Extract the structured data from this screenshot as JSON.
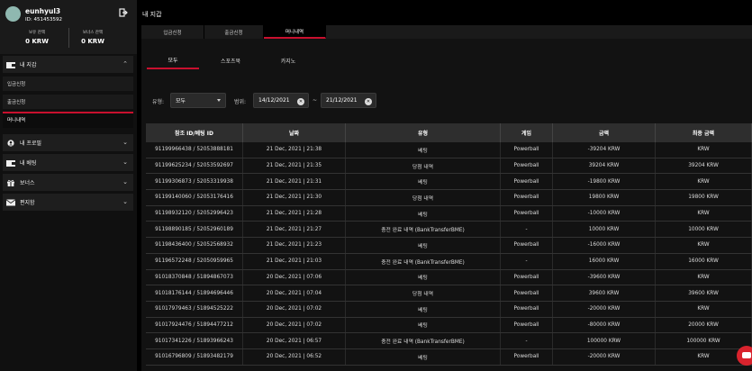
{
  "profile": {
    "username": "eunhyul3",
    "id_label": "ID: 451453592",
    "held_balance_label": "보유 잔액",
    "held_balance_value": "0 KRW",
    "bonus_balance_label": "보너스 잔액",
    "bonus_balance_value": "0 KRW"
  },
  "sidebar": {
    "wallet": "내 지갑",
    "deposit": "입금신청",
    "withdraw": "출금신청",
    "money_history": "머니내역",
    "profile": "내 프로필",
    "betting": "내 베팅",
    "bonus": "보너스",
    "mailbox": "편지함"
  },
  "main": {
    "title": "내 지갑",
    "tabs": [
      "입금신청",
      "출금신청",
      "머니내역"
    ],
    "subtabs": [
      "모두",
      "스포츠북",
      "카지노"
    ],
    "filter": {
      "type_label": "유형:",
      "type_value": "모두",
      "range_label": "범위:",
      "date_from": "14/12/2021",
      "date_sep": "~",
      "date_to": "21/12/2021"
    }
  },
  "table": {
    "headers": [
      "참조 ID/베팅 ID",
      "날짜",
      "유형",
      "게임",
      "금액",
      "최종 금액"
    ],
    "rows": [
      [
        "91199966438 / 52053888181",
        "21 Dec, 2021 | 21:38",
        "베팅",
        "Powerball",
        "-39204 KRW",
        "KRW"
      ],
      [
        "91199625234 / 52053592697",
        "21 Dec, 2021 | 21:35",
        "당첨 내역",
        "Powerball",
        "39204 KRW",
        "39204 KRW"
      ],
      [
        "91199306873 / 52053319938",
        "21 Dec, 2021 | 21:31",
        "베팅",
        "Powerball",
        "-19800 KRW",
        "KRW"
      ],
      [
        "91199140060 / 52053176416",
        "21 Dec, 2021 | 21:30",
        "당첨 내역",
        "Powerball",
        "19800 KRW",
        "19800 KRW"
      ],
      [
        "91198932120 / 52052996423",
        "21 Dec, 2021 | 21:28",
        "베팅",
        "Powerball",
        "-10000 KRW",
        "KRW"
      ],
      [
        "91198890185 / 52052960189",
        "21 Dec, 2021 | 21:27",
        "충전 완료 내역 (BankTransferBME)",
        "-",
        "10000 KRW",
        "10000 KRW"
      ],
      [
        "91198436400 / 52052568932",
        "21 Dec, 2021 | 21:23",
        "베팅",
        "Powerball",
        "-16000 KRW",
        "KRW"
      ],
      [
        "91196572248 / 52050959965",
        "21 Dec, 2021 | 21:03",
        "충전 완료 내역 (BankTransferBME)",
        "-",
        "16000 KRW",
        "16000 KRW"
      ],
      [
        "91018370848 / 51894867073",
        "20 Dec, 2021 | 07:06",
        "베팅",
        "Powerball",
        "-39600 KRW",
        "KRW"
      ],
      [
        "91018176144 / 51894696446",
        "20 Dec, 2021 | 07:04",
        "당첨 내역",
        "Powerball",
        "39600 KRW",
        "39600 KRW"
      ],
      [
        "91017979463 / 51894525222",
        "20 Dec, 2021 | 07:02",
        "베팅",
        "Powerball",
        "-20000 KRW",
        "KRW"
      ],
      [
        "91017924476 / 51894477212",
        "20 Dec, 2021 | 07:02",
        "베팅",
        "Powerball",
        "-80000 KRW",
        "20000 KRW"
      ],
      [
        "91017341226 / 51893966243",
        "20 Dec, 2021 | 06:57",
        "충전 완료 내역 (BankTransferBME)",
        "-",
        "100000 KRW",
        "100000 KRW"
      ],
      [
        "91016796809 / 51893482179",
        "20 Dec, 2021 | 06:52",
        "베팅",
        "Powerball",
        "-20000 KRW",
        "KRW"
      ]
    ]
  },
  "colors": {
    "accent": "#c8102e",
    "bg": "#000000",
    "panel": "#1a1a1a"
  }
}
